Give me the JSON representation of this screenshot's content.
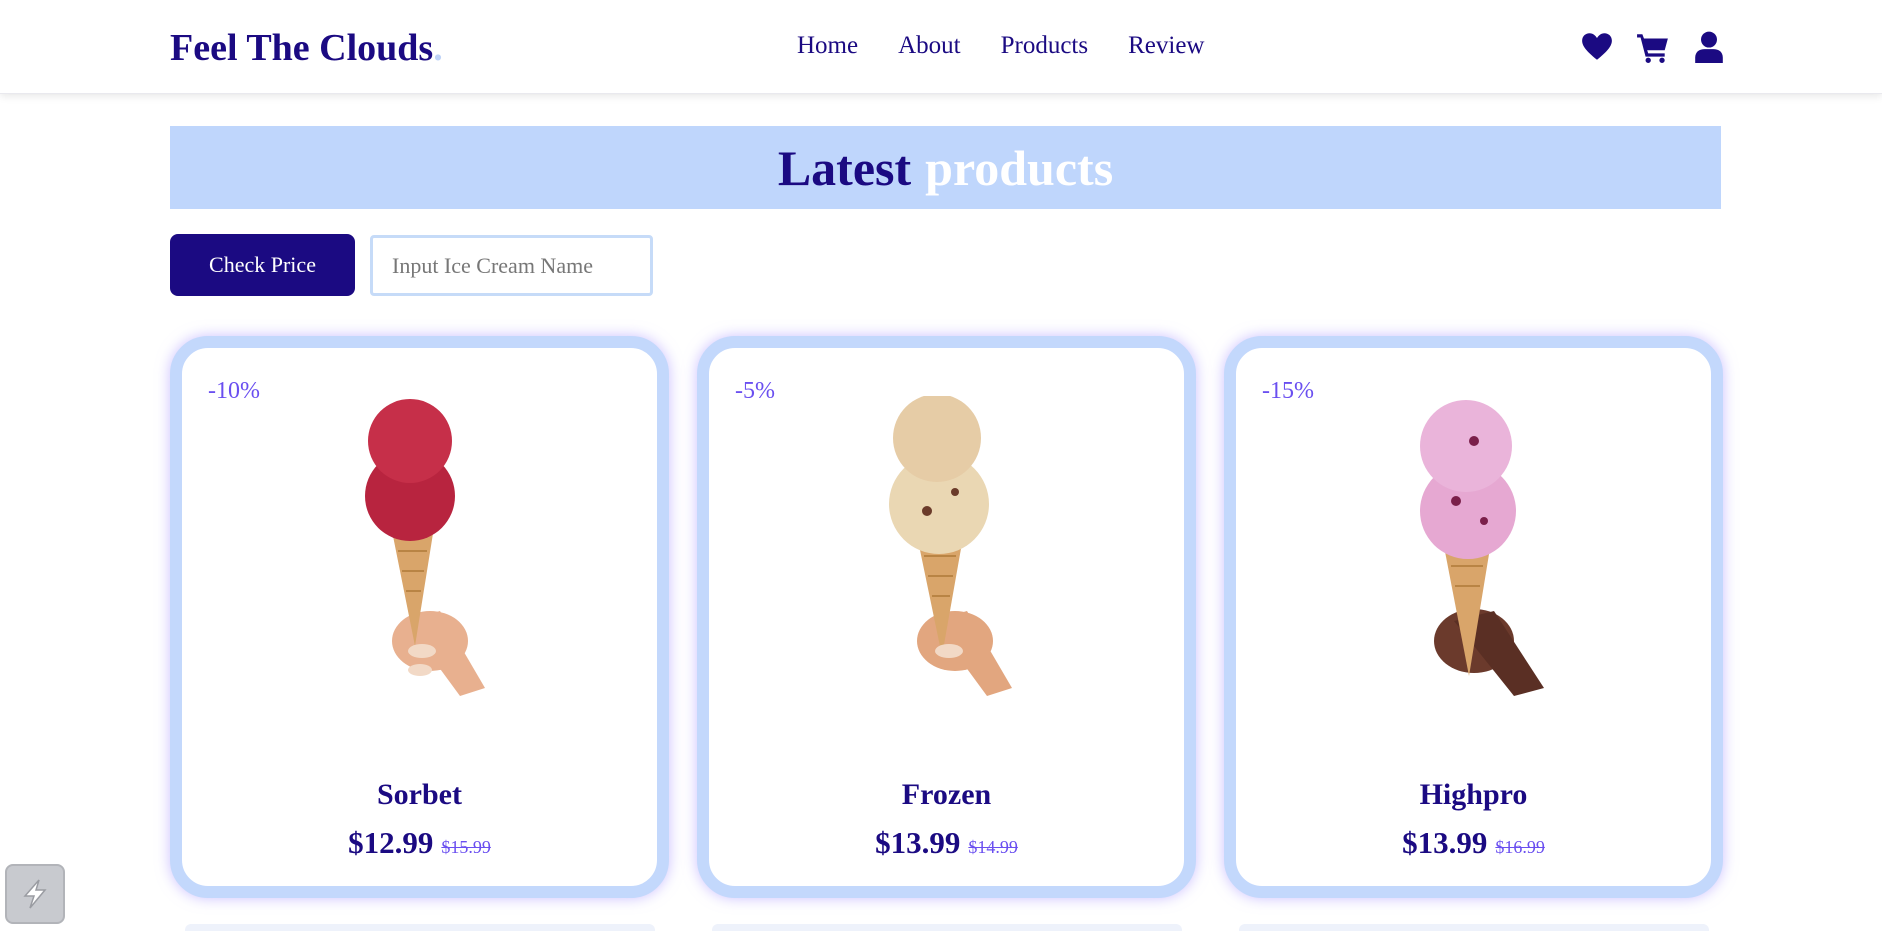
{
  "header": {
    "logo_text": "Feel The Clouds",
    "logo_dot": ".",
    "nav": [
      "Home",
      "About",
      "Products",
      "Review"
    ],
    "icons": [
      "heart-icon",
      "cart-icon",
      "user-icon"
    ]
  },
  "section": {
    "title_word1": "Latest",
    "title_word2": "products"
  },
  "controls": {
    "check_button_label": "Check Price",
    "search_placeholder": "Input Ice Cream Name",
    "search_value": ""
  },
  "products": [
    {
      "discount": "-10%",
      "name": "Sorbet",
      "price": "$12.99",
      "old_price": "$15.99",
      "scoop_color": "#b8243f"
    },
    {
      "discount": "-5%",
      "name": "Frozen",
      "price": "$13.99",
      "old_price": "$14.99",
      "scoop_color": "#e9d3ae"
    },
    {
      "discount": "-15%",
      "name": "Highpro",
      "price": "$13.99",
      "old_price": "$16.99",
      "scoop_color": "#e7a9d6"
    }
  ],
  "colors": {
    "brand": "#1b0a82",
    "accent_light": "#bfd6fc",
    "discount": "#6a4ff0"
  }
}
